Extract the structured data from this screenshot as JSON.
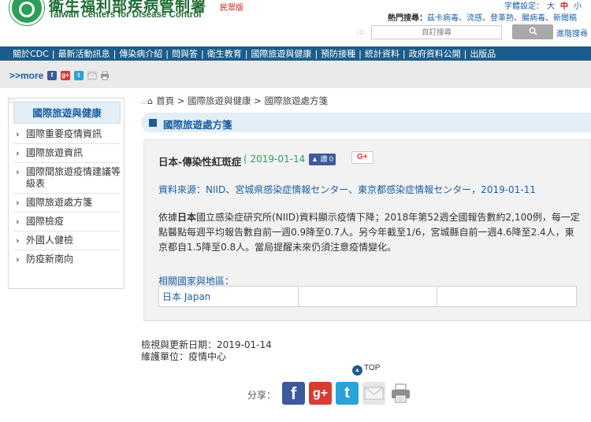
{
  "header": {
    "org_name_zh": "衛生福利部疾病管制署",
    "org_name_en": "Taiwan Centers for Disease Control",
    "civil_version": "民眾版",
    "font_size_label": "字體設定：",
    "font_sizes": [
      "大",
      "中",
      "小"
    ],
    "hot_search_label": "熱門搜尋：",
    "hot_search_terms": [
      "茲卡病毒",
      "流感",
      "登革熱",
      "腸病毒",
      "新聞稿"
    ],
    "search_placeholder": "自訂搜尋",
    "search_button_icon": "search-icon",
    "advanced_search": "進階搜尋"
  },
  "nav": {
    "items": [
      "關於CDC",
      "最新活動訊息",
      "傳染病介紹",
      "問與答",
      "衛生教育",
      "國際旅遊與健康",
      "預防接種",
      "統計資料",
      "政府資料公開",
      "出版品"
    ]
  },
  "social_band": {
    "more_label": ">>more",
    "icons": [
      "facebook-icon",
      "google-plus-icon",
      "twitter-icon",
      "email-icon",
      "print-icon"
    ]
  },
  "sidebar": {
    "title": "國際旅遊與健康",
    "items": [
      "國際重要疫情資訊",
      "國際旅遊資訊",
      "國際間旅遊疫情建議等級表",
      "國際旅遊處方箋",
      "國際檢疫",
      "外國人健檢",
      "防疫新南向"
    ]
  },
  "breadcrumb": {
    "home": "首頁",
    "trail": " > 國際旅遊與健康 > 國際旅遊處方箋"
  },
  "page": {
    "title": "國際旅遊處方箋"
  },
  "article": {
    "title": "日本-傳染性紅斑症",
    "date": "( 2019-01-14 )",
    "like_label": "讚 0",
    "gplus_label": "G+",
    "source": "資料來源：NIID、宮城県感染症情報センター、東京都感染症情報センター，2019-01-11",
    "body_prefix": "依據",
    "body_bold": "日本",
    "body_rest": "國立感染症研究所(NIID)資料顯示疫情下降；2018年第52週全國報告數約2,100例，每一定點醫點每週平均報告數自前一週0.9降至0.7人。另今年截至1/6，宮城縣自前一週4.6降至2.4人，東京都自1.5降至0.8人。當局提醒未來仍須注意疫情變化。",
    "regions_label": "相關國家與地區：",
    "regions": [
      "日本 Japan",
      "",
      ""
    ]
  },
  "footer": {
    "updated": "檢視與更新日期：2019-01-14",
    "unit": "維護單位：疫情中心",
    "top_label": "TOP",
    "share_label": "分享："
  },
  "colors": {
    "nav_bg": "#1b5d8c",
    "link_blue": "#1a5fa3",
    "date_green": "#2e9d5a",
    "facebook": "#3b5b9a",
    "google_plus": "#d73d32",
    "twitter": "#2aa3d9"
  }
}
